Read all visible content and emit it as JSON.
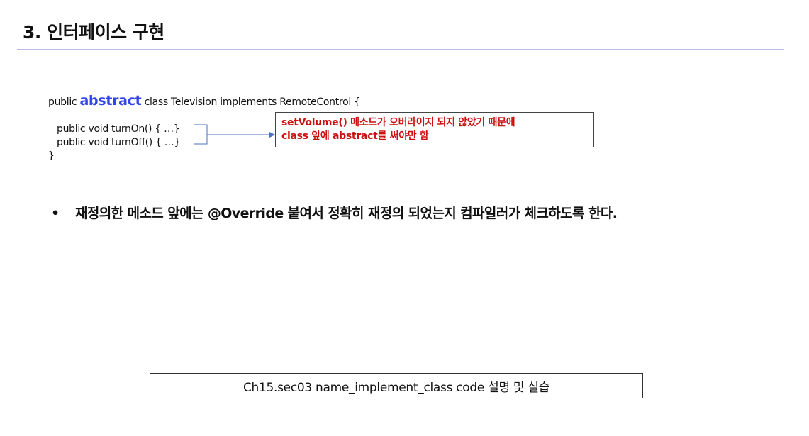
{
  "slide": {
    "title": "3. 인터페이스 구현"
  },
  "code": {
    "line1_prefix": "public ",
    "line1_keyword": "abstract",
    "line1_suffix": " class Television implements RemoteControl {",
    "line2": "public void turnOn() { …}",
    "line3": "public void turnOff() { …}",
    "line4": "}"
  },
  "note": {
    "line1": "setVolume() 메소드가 오버라이지 되지 않았기 때문에",
    "line2": "class 앞에 abstract를 써야만 함"
  },
  "bullet": {
    "marker": "•",
    "text": "재정의한 메소드 앞에는 @Override 붙여서 정확히 재정의 되었는지 컴파일러가 체크하도록 한다."
  },
  "footer_box": {
    "text": "Ch15.sec03 name_implement_class code 설명 및 실습"
  },
  "colors": {
    "keyword": "#3344ee",
    "note_text": "#cc1111",
    "arrow": "#4a72c4",
    "title_rule": "#b9b9e3"
  }
}
